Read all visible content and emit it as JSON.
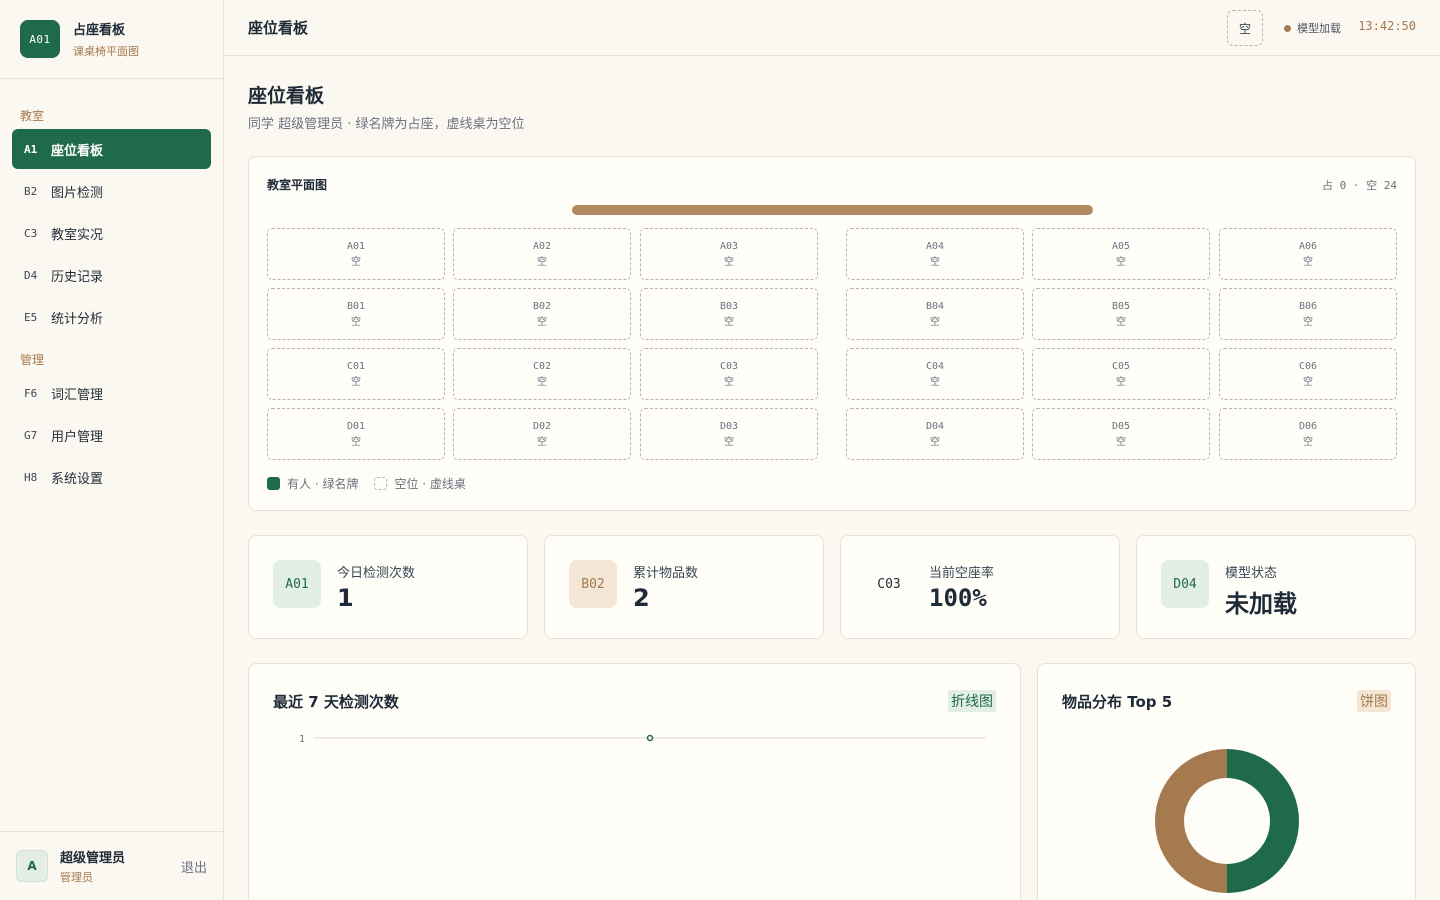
{
  "brand": {
    "logo": "A01",
    "title": "占座看板",
    "subtitle": "课桌椅平面图"
  },
  "nav": {
    "groups": [
      "教室",
      "管理"
    ],
    "items": [
      {
        "code": "A1",
        "label": "座位看板"
      },
      {
        "code": "B2",
        "label": "图片检测"
      },
      {
        "code": "C3",
        "label": "教室实况"
      },
      {
        "code": "D4",
        "label": "历史记录"
      },
      {
        "code": "E5",
        "label": "统计分析"
      },
      {
        "code": "F6",
        "label": "词汇管理"
      },
      {
        "code": "G7",
        "label": "用户管理"
      },
      {
        "code": "H8",
        "label": "系统设置"
      }
    ]
  },
  "user": {
    "avatar": "A",
    "name": "超级管理员",
    "role": "管理员",
    "logout": "退出"
  },
  "header": {
    "title": "座位看板",
    "btn": "空",
    "model_status": "模型加载",
    "clock": "13:42:50"
  },
  "page": {
    "title": "座位看板",
    "subtitle": "同学 超级管理员 · 绿名牌为占座，虚线桌为空位"
  },
  "plan": {
    "title": "教室平面图",
    "count": "占 0 · 空 24",
    "rows": [
      [
        {
          "id": "A01",
          "s": "空"
        },
        {
          "id": "A02",
          "s": "空"
        },
        {
          "id": "A03",
          "s": "空"
        },
        {
          "id": "A04",
          "s": "空"
        },
        {
          "id": "A05",
          "s": "空"
        },
        {
          "id": "A06",
          "s": "空"
        }
      ],
      [
        {
          "id": "B01",
          "s": "空"
        },
        {
          "id": "B02",
          "s": "空"
        },
        {
          "id": "B03",
          "s": "空"
        },
        {
          "id": "B04",
          "s": "空"
        },
        {
          "id": "B05",
          "s": "空"
        },
        {
          "id": "B06",
          "s": "空"
        }
      ],
      [
        {
          "id": "C01",
          "s": "空"
        },
        {
          "id": "C02",
          "s": "空"
        },
        {
          "id": "C03",
          "s": "空"
        },
        {
          "id": "C04",
          "s": "空"
        },
        {
          "id": "C05",
          "s": "空"
        },
        {
          "id": "C06",
          "s": "空"
        }
      ],
      [
        {
          "id": "D01",
          "s": "空"
        },
        {
          "id": "D02",
          "s": "空"
        },
        {
          "id": "D03",
          "s": "空"
        },
        {
          "id": "D04",
          "s": "空"
        },
        {
          "id": "D05",
          "s": "空"
        },
        {
          "id": "D06",
          "s": "空"
        }
      ]
    ],
    "legend_occupied": "有人 · 绿名牌",
    "legend_empty": "空位 · 虚线桌"
  },
  "stats": [
    {
      "icon": "A01",
      "label": "今日检测次数",
      "value": "1"
    },
    {
      "icon": "B02",
      "label": "累计物品数",
      "value": "2"
    },
    {
      "icon": "C03",
      "label": "当前空座率",
      "value": "100%"
    },
    {
      "icon": "D04",
      "label": "模型状态",
      "value": "未加载"
    }
  ],
  "colors": {
    "accent": "#1f6a4a",
    "brown": "#a57a4e",
    "bg": "#fbf8f1"
  },
  "line_chart": {
    "title": "最近 7 天检测次数",
    "tag": "折线图",
    "chart_data": {
      "type": "line",
      "y_ticks": [
        "1"
      ],
      "ylim": [
        0,
        1
      ],
      "points": [
        {
          "index": 3,
          "y": 1
        }
      ],
      "n_points": 7
    }
  },
  "pie_chart": {
    "title": "物品分布 Top 5",
    "tag": "饼图",
    "chart_data": {
      "type": "pie",
      "donut": true,
      "values": [
        1,
        1
      ],
      "colors": [
        "#1f6a4a",
        "#a57a4e"
      ]
    }
  }
}
